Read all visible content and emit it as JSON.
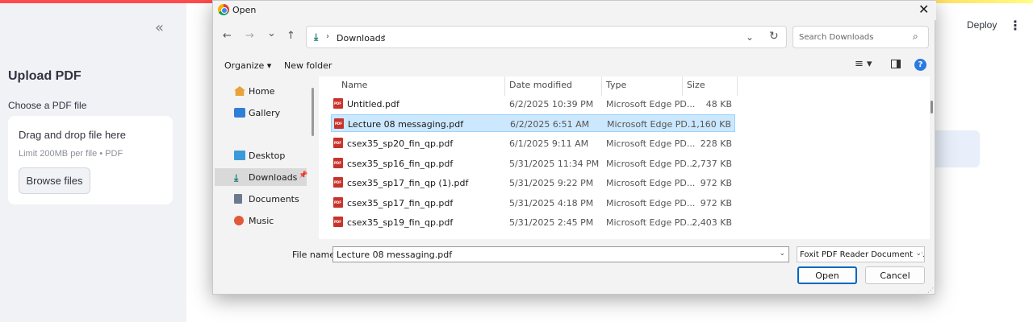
{
  "app": {
    "sidebar_collapse_glyph": "«",
    "sidebar_title": "Upload PDF",
    "uploader_label": "Choose a PDF file",
    "dropzone_title": "Drag and drop file here",
    "dropzone_limit": "Limit 200MB per file • PDF",
    "browse_label": "Browse files",
    "deploy_label": "Deploy",
    "menu_glyph": "⋮"
  },
  "dialog": {
    "title": "Open",
    "close_glyph": "✕",
    "nav": {
      "back": "←",
      "forward": "→",
      "recent": "⌄",
      "up": "↑"
    },
    "address": {
      "crumb": "Downloads",
      "sep": "›",
      "dropdown": "⌄",
      "refresh": "↻"
    },
    "search": {
      "placeholder": "Search Downloads",
      "icon": "⌕"
    },
    "toolbar": {
      "organize": "Organize ▾",
      "new_folder": "New folder",
      "view": "≡ ▾",
      "help": "?"
    },
    "nav_pane": [
      {
        "label": "Home",
        "icon": "home-icon",
        "pinned": false
      },
      {
        "label": "Gallery",
        "icon": "gallery-icon",
        "pinned": false
      },
      {
        "label": "Desktop",
        "icon": "desktop-icon",
        "pinned": true
      },
      {
        "label": "Downloads",
        "icon": "downloads-icon",
        "pinned": true,
        "selected": true
      },
      {
        "label": "Documents",
        "icon": "documents-icon",
        "pinned": true
      },
      {
        "label": "Music",
        "icon": "music-icon",
        "pinned": true
      }
    ],
    "pin_glyph": "📌",
    "columns": {
      "name": "Name",
      "date": "Date modified",
      "type": "Type",
      "size": "Size"
    },
    "files": [
      {
        "name": "Untitled.pdf",
        "date": "6/2/2025 10:39 PM",
        "type": "Microsoft Edge PD...",
        "size": "48 KB",
        "selected": false
      },
      {
        "name": "Lecture 08 messaging.pdf",
        "date": "6/2/2025 6:51 AM",
        "type": "Microsoft Edge PD...",
        "size": "1,160 KB",
        "selected": true
      },
      {
        "name": "csex35_sp20_fin_qp.pdf",
        "date": "6/1/2025 9:11 AM",
        "type": "Microsoft Edge PD...",
        "size": "228 KB",
        "selected": false
      },
      {
        "name": "csex35_sp16_fin_qp.pdf",
        "date": "5/31/2025 11:34 PM",
        "type": "Microsoft Edge PD...",
        "size": "2,737 KB",
        "selected": false
      },
      {
        "name": "csex35_sp17_fin_qp (1).pdf",
        "date": "5/31/2025 9:22 PM",
        "type": "Microsoft Edge PD...",
        "size": "972 KB",
        "selected": false
      },
      {
        "name": "csex35_sp17_fin_qp.pdf",
        "date": "5/31/2025 4:18 PM",
        "type": "Microsoft Edge PD...",
        "size": "972 KB",
        "selected": false
      },
      {
        "name": "csex35_sp19_fin_qp.pdf",
        "date": "5/31/2025 2:45 PM",
        "type": "Microsoft Edge PD...",
        "size": "2,403 KB",
        "selected": false
      }
    ],
    "file_name_label": "File name:",
    "file_name_value": "Lecture 08 messaging.pdf",
    "file_type_value": "Foxit PDF Reader Document (*.pdf)",
    "dropdown_glyph": "⌄",
    "open_label": "Open",
    "cancel_label": "Cancel",
    "resize_glyph": "⋰"
  },
  "colors": {
    "accent": "#0067c0",
    "selection": "#cce8ff",
    "sidebar_bg": "#f0f2f6",
    "pdf_icon": "#c8332b"
  }
}
